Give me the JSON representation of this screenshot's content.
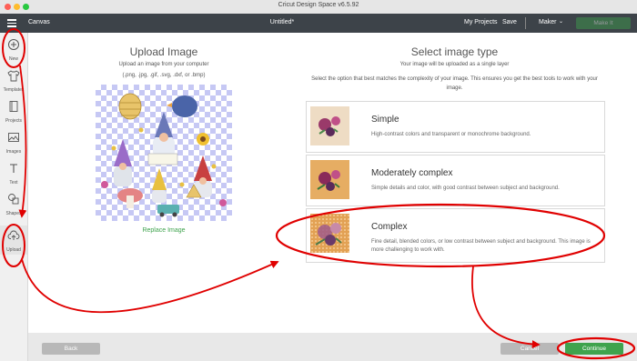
{
  "window": {
    "title": "Cricut Design Space  v6.5.92"
  },
  "header": {
    "canvas_label": "Canvas",
    "project_title": "Untitled*",
    "my_projects": "My Projects",
    "save": "Save",
    "machine": "Maker",
    "make_it": "Make It"
  },
  "sidebar": {
    "items": [
      {
        "label": "New",
        "icon": "plus-icon"
      },
      {
        "label": "Templates",
        "icon": "shirt-icon"
      },
      {
        "label": "Projects",
        "icon": "projects-icon"
      },
      {
        "label": "Images",
        "icon": "image-icon"
      },
      {
        "label": "Text",
        "icon": "text-icon"
      },
      {
        "label": "Shapes",
        "icon": "shapes-icon"
      },
      {
        "label": "Upload",
        "icon": "cloud-upload-icon"
      }
    ]
  },
  "upload_panel": {
    "title": "Upload Image",
    "subtitle": "Upload an image from your computer",
    "formats": "(.png, .jpg, .gif, .svg, .dxf, or .bmp)",
    "replace": "Replace Image"
  },
  "type_panel": {
    "title": "Select image type",
    "subtitle": "Your image will be uploaded as a single layer",
    "instructions": "Select the option that best matches the complexity of your image. This ensures you get the best tools to work with your image.",
    "options": [
      {
        "title": "Simple",
        "desc": "High-contrast colors and transparent or monochrome background.",
        "bg": "#eedcc4"
      },
      {
        "title": "Moderately complex",
        "desc": "Simple details and color, with good contrast between subject and background.",
        "bg": "#e6ad63"
      },
      {
        "title": "Complex",
        "desc": "Fine detail, blended colors, or low contrast between subject and background. This image is more challenging to work with.",
        "bg": "#e2a154"
      }
    ]
  },
  "footer": {
    "back": "Back",
    "cancel": "Cancel",
    "continue": "Continue"
  },
  "colors": {
    "accent_green": "#3fa34d",
    "header": "#3d4349",
    "annotation_red": "#e00000"
  }
}
